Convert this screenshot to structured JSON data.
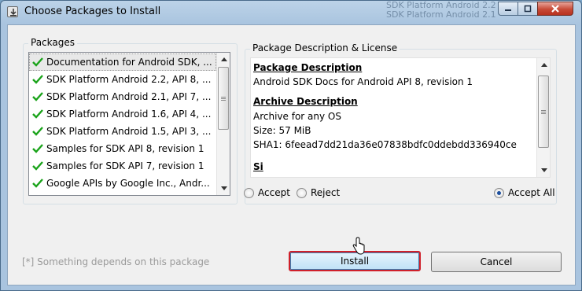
{
  "window": {
    "title": "Choose Packages to Install",
    "background_glimpse": [
      "SDK Platform Android 2.2,",
      "SDK Platform Android 2.1,"
    ]
  },
  "packages": {
    "group_label": "Packages",
    "items": [
      {
        "label": "Documentation for Android SDK, ...",
        "checked": true,
        "selected": true
      },
      {
        "label": "SDK Platform Android 2.2, API 8, ...",
        "checked": true
      },
      {
        "label": "SDK Platform Android 2.1, API 7, ...",
        "checked": true
      },
      {
        "label": "SDK Platform Android 1.6, API 4, ...",
        "checked": true
      },
      {
        "label": "SDK Platform Android 1.5, API 3, ...",
        "checked": true
      },
      {
        "label": "Samples for SDK API 8, revision 1",
        "checked": true
      },
      {
        "label": "Samples for SDK API 7, revision 1",
        "checked": true
      },
      {
        "label": "Google APIs by Google Inc., Andr...",
        "checked": true
      }
    ]
  },
  "description": {
    "group_label": "Package Description & License",
    "package_heading": "Package Description",
    "package_text": "Android SDK Docs for Android API 8, revision 1",
    "archive_heading": "Archive Description",
    "archive_lines": [
      "Archive for any OS",
      "Size: 57 MiB",
      "SHA1: 6feead7dd21da36e07838bdfc0ddebdd336940ce"
    ],
    "clipped_text": "Si"
  },
  "options": {
    "accept": "Accept",
    "reject": "Reject",
    "accept_all": "Accept All",
    "selected": "Accept All"
  },
  "hint": "[*] Something depends on this package",
  "buttons": {
    "install": "Install",
    "cancel": "Cancel"
  },
  "colors": {
    "check": "#1aa31a",
    "install_highlight": "#d0202a"
  }
}
